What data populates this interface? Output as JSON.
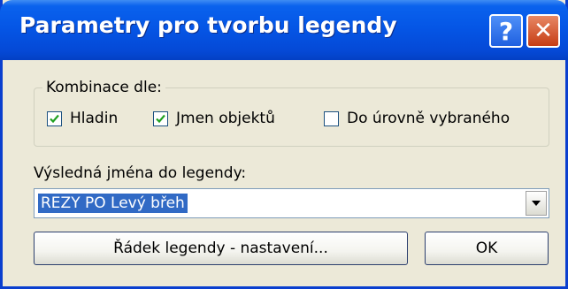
{
  "window": {
    "title": "Parametry pro tvorbu legendy",
    "help_label": "?",
    "close_label": "✕"
  },
  "combination": {
    "legend": "Kombinace dle:",
    "options": [
      {
        "label": "Hladin",
        "checked": true
      },
      {
        "label": "Jmen objektů",
        "checked": true
      },
      {
        "label": "Do úrovně vybraného",
        "checked": false
      }
    ]
  },
  "result": {
    "label": "Výsledná jména do legendy:",
    "selected_value": "REZY PO Levý břeh"
  },
  "buttons": {
    "row_settings": "Řádek legendy - nastavení...",
    "ok": "OK"
  },
  "colors": {
    "title_bar": "#0556e6",
    "dialog_bg": "#ece9d8",
    "selection": "#316ac5"
  }
}
